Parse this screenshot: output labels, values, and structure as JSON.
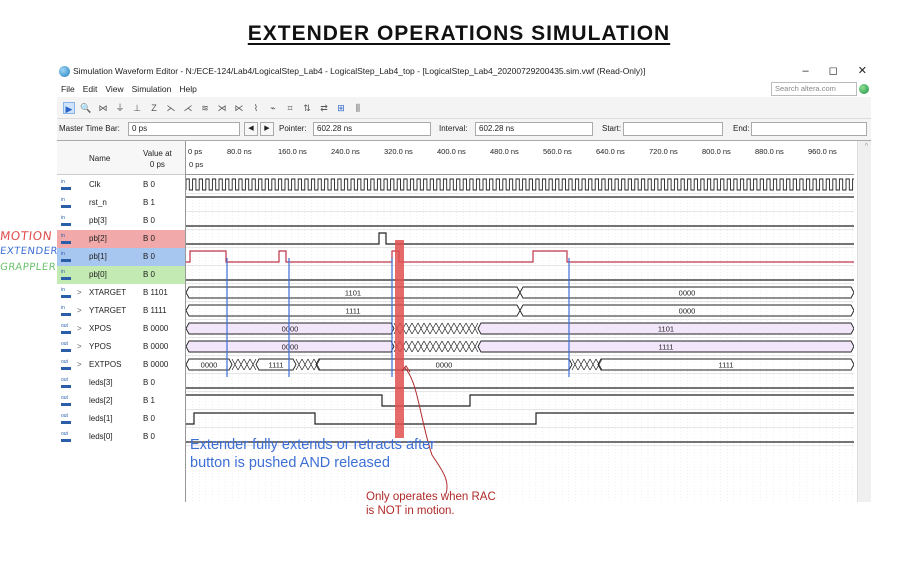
{
  "slide_title": "EXTENDER OPERATIONS SIMULATION",
  "window": {
    "title": "Simulation Waveform Editor - N:/ECE-124/Lab4/LogicalStep_Lab4 - LogicalStep_Lab4_top - [LogicalStep_Lab4_20200729200435.sim.vwf (Read-Only)]",
    "controls": [
      "–",
      "◻",
      "✕"
    ],
    "search_placeholder": "Search altera.com"
  },
  "menu": [
    "File",
    "Edit",
    "View",
    "Simulation",
    "Help"
  ],
  "timebar": {
    "master_label": "Master Time Bar:",
    "master_value": "0 ps",
    "pointer_label": "Pointer:",
    "pointer_value": "602.28 ns",
    "interval_label": "Interval:",
    "interval_value": "602.28 ns",
    "start_label": "Start:",
    "start_value": "",
    "end_label": "End:",
    "end_value": ""
  },
  "columns": {
    "name": "Name",
    "value_line1": "Value at",
    "value_line2": "0 ps"
  },
  "ruler": {
    "ticks": [
      "0 ps",
      "80.0 ns",
      "160.0 ns",
      "240.0 ns",
      "320.0 ns",
      "400.0 ns",
      "480.0 ns",
      "560.0 ns",
      "640.0 ns",
      "720.0 ns",
      "800.0 ns",
      "880.0 ns",
      "960.0 ns"
    ],
    "cursor_label": "0 ps"
  },
  "signals": [
    {
      "name": "Clk",
      "value": "B 0",
      "type": "in",
      "expandable": false
    },
    {
      "name": "rst_n",
      "value": "B 1",
      "type": "in",
      "expandable": false
    },
    {
      "name": "pb[3]",
      "value": "B 0",
      "type": "in",
      "expandable": false
    },
    {
      "name": "pb[2]",
      "value": "B 0",
      "type": "in",
      "expandable": false
    },
    {
      "name": "pb[1]",
      "value": "B 0",
      "type": "in",
      "expandable": false
    },
    {
      "name": "pb[0]",
      "value": "B 0",
      "type": "in",
      "expandable": false
    },
    {
      "name": "XTARGET",
      "value": "B 1101",
      "type": "in",
      "expandable": true
    },
    {
      "name": "YTARGET",
      "value": "B 1111",
      "type": "in",
      "expandable": true
    },
    {
      "name": "XPOS",
      "value": "B 0000",
      "type": "out",
      "expandable": true
    },
    {
      "name": "YPOS",
      "value": "B 0000",
      "type": "out",
      "expandable": true
    },
    {
      "name": "EXTPOS",
      "value": "B 0000",
      "type": "out",
      "expandable": true
    },
    {
      "name": "leds[3]",
      "value": "B 0",
      "type": "out",
      "expandable": false
    },
    {
      "name": "leds[2]",
      "value": "B 1",
      "type": "out",
      "expandable": false
    },
    {
      "name": "leds[1]",
      "value": "B 0",
      "type": "out",
      "expandable": false
    },
    {
      "name": "leds[0]",
      "value": "B 0",
      "type": "out",
      "expandable": false
    }
  ],
  "bus_labels": {
    "xtarget": [
      "1101",
      "0000"
    ],
    "ytarget": [
      "1111",
      "0000"
    ],
    "xpos": [
      "0000",
      "1101"
    ],
    "ypos": [
      "0000",
      "1111"
    ],
    "extpos": [
      "0000",
      "1111",
      "0000",
      "1111"
    ]
  },
  "side_labels": {
    "motion": "MOTION",
    "extender": "EXTENDER",
    "grappler": "GRAPPLER"
  },
  "notes": {
    "blue": "Extender fully extends or retracts after button is pushed AND released",
    "red": "Only operates when RAC is NOT in motion."
  },
  "colors": {
    "annotation_red": "#e05050",
    "annotation_blue": "#3d6fd6",
    "highlight_red": "#f2a9a9",
    "highlight_blue": "#a8c7f0",
    "highlight_green": "#c3eab2"
  }
}
